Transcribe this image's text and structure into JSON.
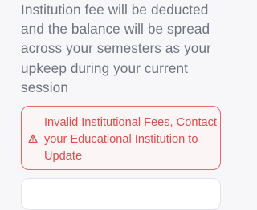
{
  "info": {
    "text": "Institution fee will be deducted and the balance will be spread across your semesters as your upkeep during your current session"
  },
  "error": {
    "icon": "warning-triangle-icon",
    "message": "Invalid Institutional Fees, Contact your Educational Institution to Update",
    "color": "#e04b4b"
  }
}
